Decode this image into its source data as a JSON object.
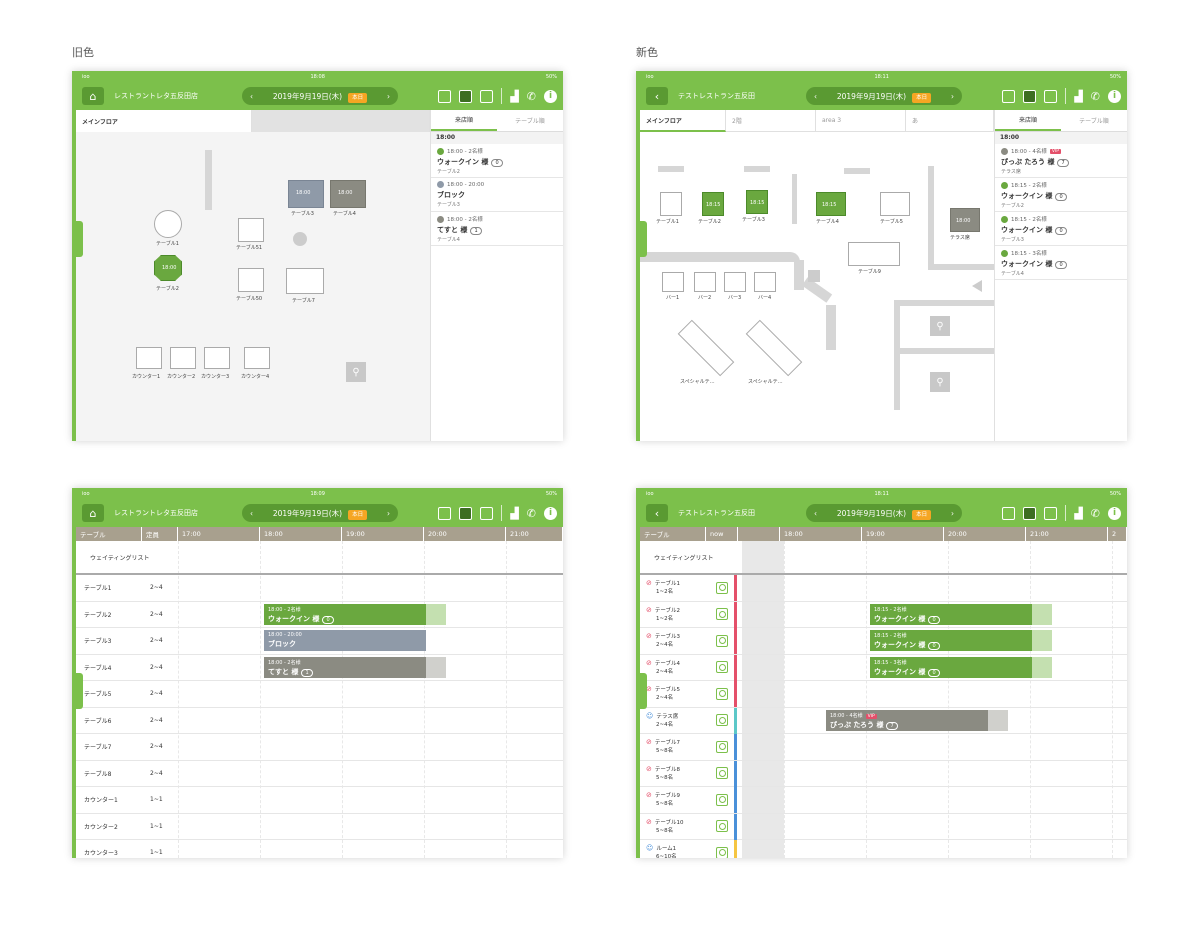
{
  "headings": {
    "old": "旧色",
    "new": "新色"
  },
  "status": {
    "left": "ioo",
    "time_tl": "18:08",
    "time_tr": "18:11",
    "time_bl": "18:09",
    "time_br": "18:11",
    "battery": "50%"
  },
  "nav": {
    "old_store": "レストラントレタ五反田店",
    "new_store": "テストレストラン五反田",
    "date": "2019年9月19日(木)",
    "today": "本日",
    "prev": "‹",
    "next": "›"
  },
  "floor_tabs": {
    "old": [
      "メインフロア"
    ],
    "new": [
      "メインフロア",
      "2階",
      "area 3",
      "あ"
    ]
  },
  "side_tabs": [
    "来店順",
    "テーブル順"
  ],
  "side_time": "18:00",
  "old_list": [
    {
      "time": "18:00 - 2名様",
      "name": "ウォークイン 様",
      "count": "0",
      "table": "テーブル2",
      "color": "#6aa83f"
    },
    {
      "time": "18:00 - 20:00",
      "name": "ブロック",
      "count": "",
      "table": "テーブル3",
      "color": "#8f9aa8"
    },
    {
      "time": "18:00 - 2名様",
      "name": "てすと 様",
      "count": "1",
      "table": "テーブル4",
      "color": "#8b8b82"
    }
  ],
  "new_list": [
    {
      "time": "18:00 - 4名様",
      "vip": "VIP",
      "name": "ぴっぷ たろう 様",
      "count": "7",
      "table": "テラス席",
      "color": "#8b8b82"
    },
    {
      "time": "18:15 - 2名様",
      "name": "ウォークイン 様",
      "count": "0",
      "table": "テーブル2",
      "color": "#6aa83f"
    },
    {
      "time": "18:15 - 2名様",
      "name": "ウォークイン 様",
      "count": "0",
      "table": "テーブル3",
      "color": "#6aa83f"
    },
    {
      "time": "18:15 - 3名様",
      "name": "ウォークイン 様",
      "count": "0",
      "table": "テーブル4",
      "color": "#6aa83f"
    }
  ],
  "old_tables": {
    "t1": "テーブル1",
    "t2": "テーブル2",
    "t3": "テーブル3",
    "t4": "テーブル4",
    "t51": "テーブル51",
    "t50": "テーブル50",
    "t7": "テーブル7",
    "c1": "カウンター1",
    "c2": "カウンター2",
    "c3": "カウンター3",
    "c4": "カウンター4",
    "time": "18:00"
  },
  "new_tables": {
    "t1": "テーブル1",
    "t2": "テーブル2",
    "t3": "テーブル3",
    "t4": "テーブル4",
    "t5": "テーブル5",
    "t9": "テーブル9",
    "terrace": "テラス席",
    "b1": "バー1",
    "b2": "バー2",
    "b3": "バー3",
    "b4": "バー4",
    "sp1": "スペシャルテ…",
    "sp2": "スペシャルテ…",
    "time": "18:00",
    "time2": "18:15"
  },
  "old_timeline": {
    "hdr_table": "テーブル",
    "hdr_cap": "定員",
    "hours": [
      "17:00",
      "18:00",
      "19:00",
      "20:00",
      "21:00"
    ],
    "waiting": "ウェイティングリスト",
    "rows": [
      [
        "テーブル1",
        "2~4"
      ],
      [
        "テーブル2",
        "2~4"
      ],
      [
        "テーブル3",
        "2~4"
      ],
      [
        "テーブル4",
        "2~4"
      ],
      [
        "テーブル5",
        "2~4"
      ],
      [
        "テーブル6",
        "2~4"
      ],
      [
        "テーブル7",
        "2~4"
      ],
      [
        "テーブル8",
        "2~4"
      ],
      [
        "カウンター1",
        "1~1"
      ],
      [
        "カウンター2",
        "1~1"
      ],
      [
        "カウンター3",
        "1~1"
      ]
    ],
    "bars": [
      {
        "time": "18:00 - 2名様",
        "name": "ウォークイン 様",
        "count": "0"
      },
      {
        "time": "18:00 - 20:00",
        "name": "ブロック"
      },
      {
        "time": "18:00 - 2名様",
        "name": "てすと 様",
        "count": "1"
      }
    ]
  },
  "new_timeline": {
    "hdr_table": "テーブル",
    "hdr_now": "now",
    "hours": [
      "18:00",
      "19:00",
      "20:00",
      "21:00",
      "2"
    ],
    "waiting": "ウェイティングリスト",
    "rows": [
      [
        "テーブル1",
        "1~2名"
      ],
      [
        "テーブル2",
        "1~2名"
      ],
      [
        "テーブル3",
        "2~4名"
      ],
      [
        "テーブル4",
        "2~4名"
      ],
      [
        "テーブル5",
        "2~4名"
      ],
      [
        "テラス席",
        "2~4名"
      ],
      [
        "テーブル7",
        "5~8名"
      ],
      [
        "テーブル8",
        "5~8名"
      ],
      [
        "テーブル9",
        "5~8名"
      ],
      [
        "テーブル10",
        "5~8名"
      ],
      [
        "ルーム1",
        "6~10名"
      ]
    ],
    "bars": [
      {
        "time": "18:15 - 2名様",
        "name": "ウォークイン 様",
        "count": "0"
      },
      {
        "time": "18:15 - 2名様",
        "name": "ウォークイン 様",
        "count": "0"
      },
      {
        "time": "18:15 - 3名様",
        "name": "ウォークイン 様",
        "count": "0"
      },
      {
        "time": "18:00 - 4名様",
        "vip": "VIP",
        "name": "ぴっぷ たろう 様",
        "count": "7"
      }
    ]
  }
}
